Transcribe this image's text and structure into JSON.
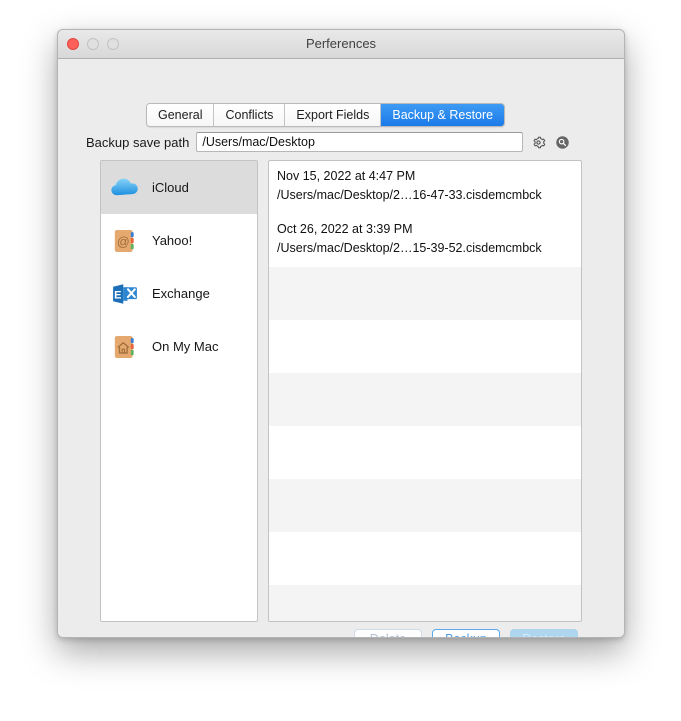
{
  "window": {
    "title": "Perferences",
    "traffic_lights": [
      "close",
      "minimize",
      "maximize"
    ]
  },
  "tabs": [
    {
      "label": "General",
      "selected": false
    },
    {
      "label": "Conflicts",
      "selected": false
    },
    {
      "label": "Export Fields",
      "selected": false
    },
    {
      "label": "Backup & Restore",
      "selected": true
    }
  ],
  "path_row": {
    "label": "Backup save path",
    "value": "/Users/mac/Desktop",
    "placeholder": "",
    "gear_icon": "gear-icon",
    "search_icon": "search-icon"
  },
  "accounts": [
    {
      "label": "iCloud",
      "icon": "icloud-icon",
      "selected": true
    },
    {
      "label": "Yahoo!",
      "icon": "yahoo-contacts-icon",
      "selected": false
    },
    {
      "label": "Exchange",
      "icon": "exchange-icon",
      "selected": false
    },
    {
      "label": "On My Mac",
      "icon": "on-my-mac-icon",
      "selected": false
    }
  ],
  "backups": [
    {
      "date": "Nov 15, 2022 at 4:47 PM",
      "path": "/Users/mac/Desktop/2…16-47-33.cisdemcmbck"
    },
    {
      "date": "Oct 26, 2022 at 3:39 PM",
      "path": "/Users/mac/Desktop/2…15-39-52.cisdemcmbck"
    }
  ],
  "footer": {
    "delete_label": "Delete",
    "backup_label": "Backup",
    "restore_label": "Restore"
  },
  "colors": {
    "tab_selected": "#1a7ae8",
    "window_bg": "#ececec",
    "selection": "#dcdcdc",
    "row_alt": "#f4f4f4",
    "restore_fill": "#aed6ef",
    "backup_border": "#5aa9ec"
  }
}
